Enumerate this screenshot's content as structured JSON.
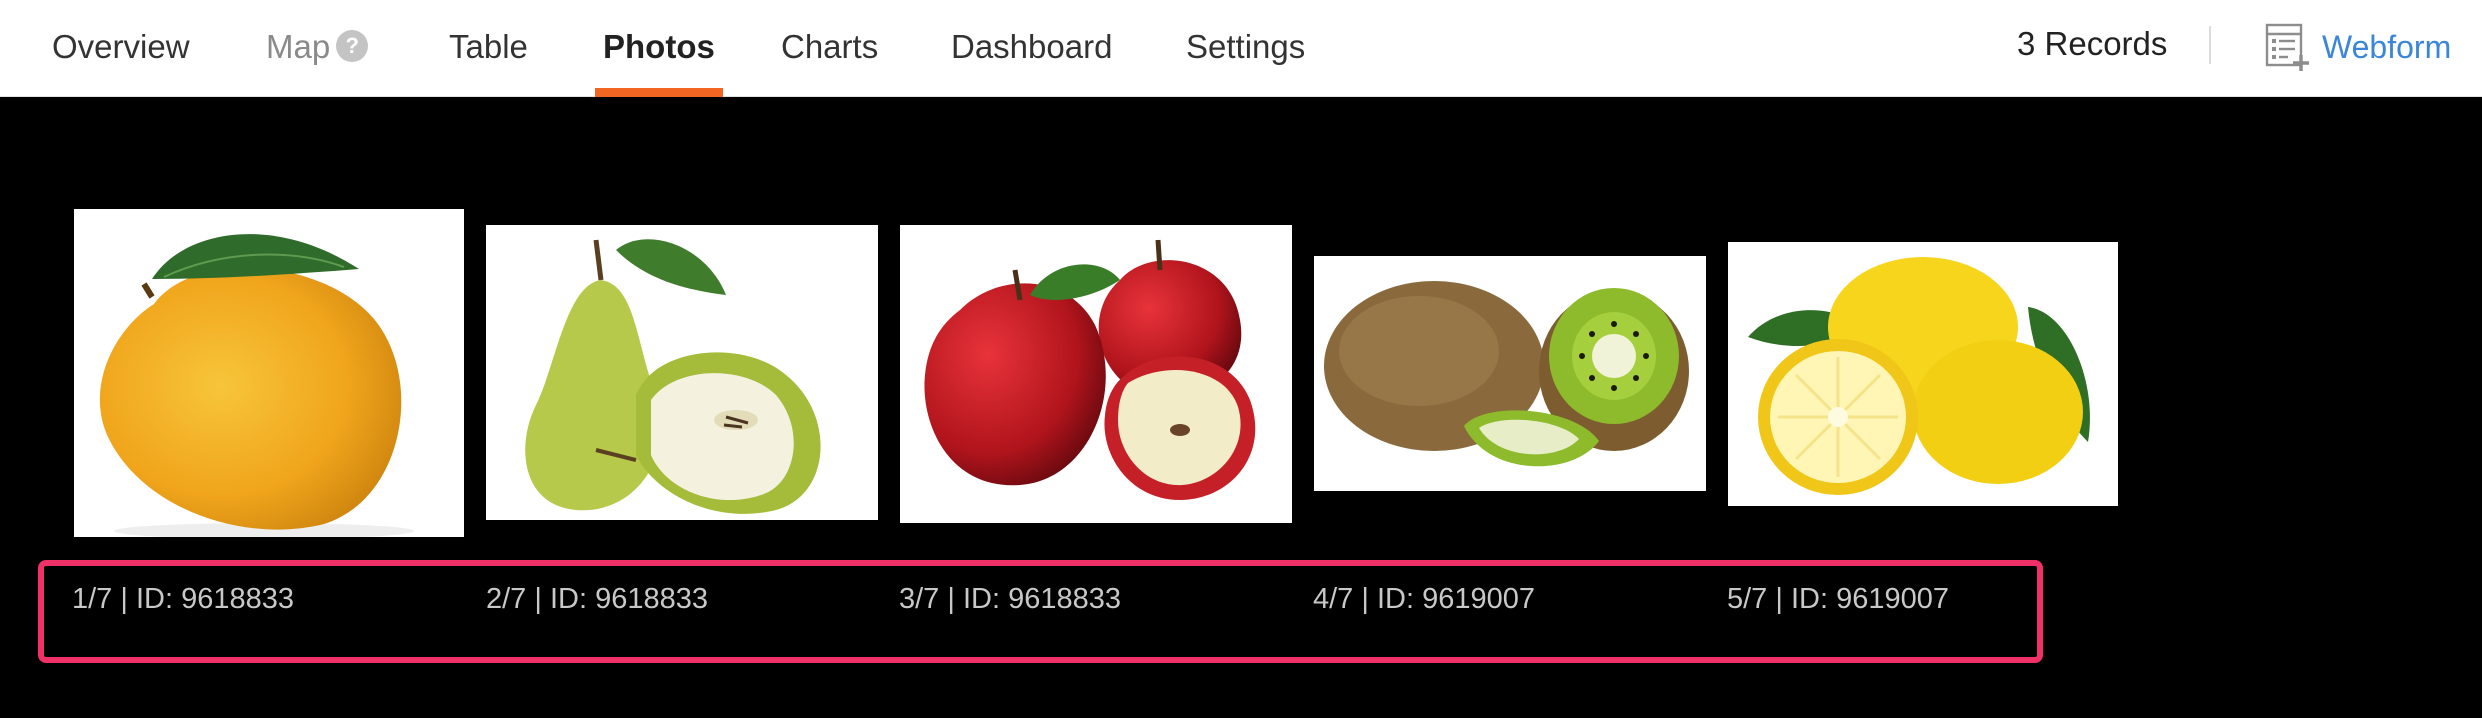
{
  "nav": {
    "tabs": [
      {
        "label": "Overview"
      },
      {
        "label": "Map"
      },
      {
        "label": "Table"
      },
      {
        "label": "Photos"
      },
      {
        "label": "Charts"
      },
      {
        "label": "Dashboard"
      },
      {
        "label": "Settings"
      }
    ],
    "active_tab": "Photos",
    "help_glyph": "?",
    "records_label": "3 Records",
    "webform_label": "Webform",
    "accent_color": "#f26522",
    "link_color": "#3b86d8"
  },
  "gallery": {
    "highlight_color": "#ef3168",
    "photos": [
      {
        "subject": "mango",
        "caption": "1/7 | ID: 9618833"
      },
      {
        "subject": "pear",
        "caption": "2/7 | ID: 9618833"
      },
      {
        "subject": "apple",
        "caption": "3/7 | ID: 9618833"
      },
      {
        "subject": "kiwi",
        "caption": "4/7 | ID: 9619007"
      },
      {
        "subject": "lemon",
        "caption": "5/7 | ID: 9619007"
      }
    ]
  }
}
